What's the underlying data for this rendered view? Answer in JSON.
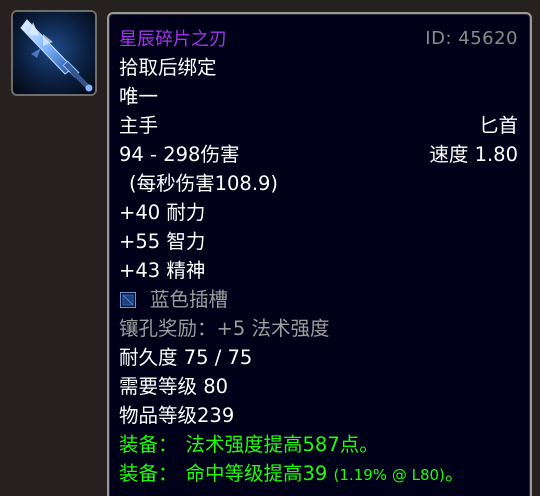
{
  "icon": {
    "name": "dagger-icon"
  },
  "item": {
    "name": "星辰碎片之刃",
    "id_label": "ID: 45620",
    "binding": "拾取后绑定",
    "unique": "唯一",
    "slot": "主手",
    "weapon_type": "匕首",
    "damage": "94 - 298伤害",
    "speed": "速度 1.80",
    "dps": "(每秒伤害108.9)",
    "stats": [
      "+40 耐力",
      "+55 智力",
      "+43 精神"
    ],
    "socket": "蓝色插槽",
    "socket_bonus": "镶孔奖励：+5 法术强度",
    "durability": "耐久度 75 / 75",
    "required_level": "需要等级 80",
    "item_level": "物品等级239",
    "equip1_label": "装备：",
    "equip1_text": "法术强度提高587点。",
    "equip2_label": "装备：",
    "equip2_text": "命中等级提高39",
    "equip2_detail": "(1.19% @ L80)",
    "equip2_end": "。"
  },
  "colors": {
    "epic": "#a335ee",
    "uncommon_green": "#1eff00",
    "gray": "#9d9d9d",
    "background": "#000019"
  }
}
